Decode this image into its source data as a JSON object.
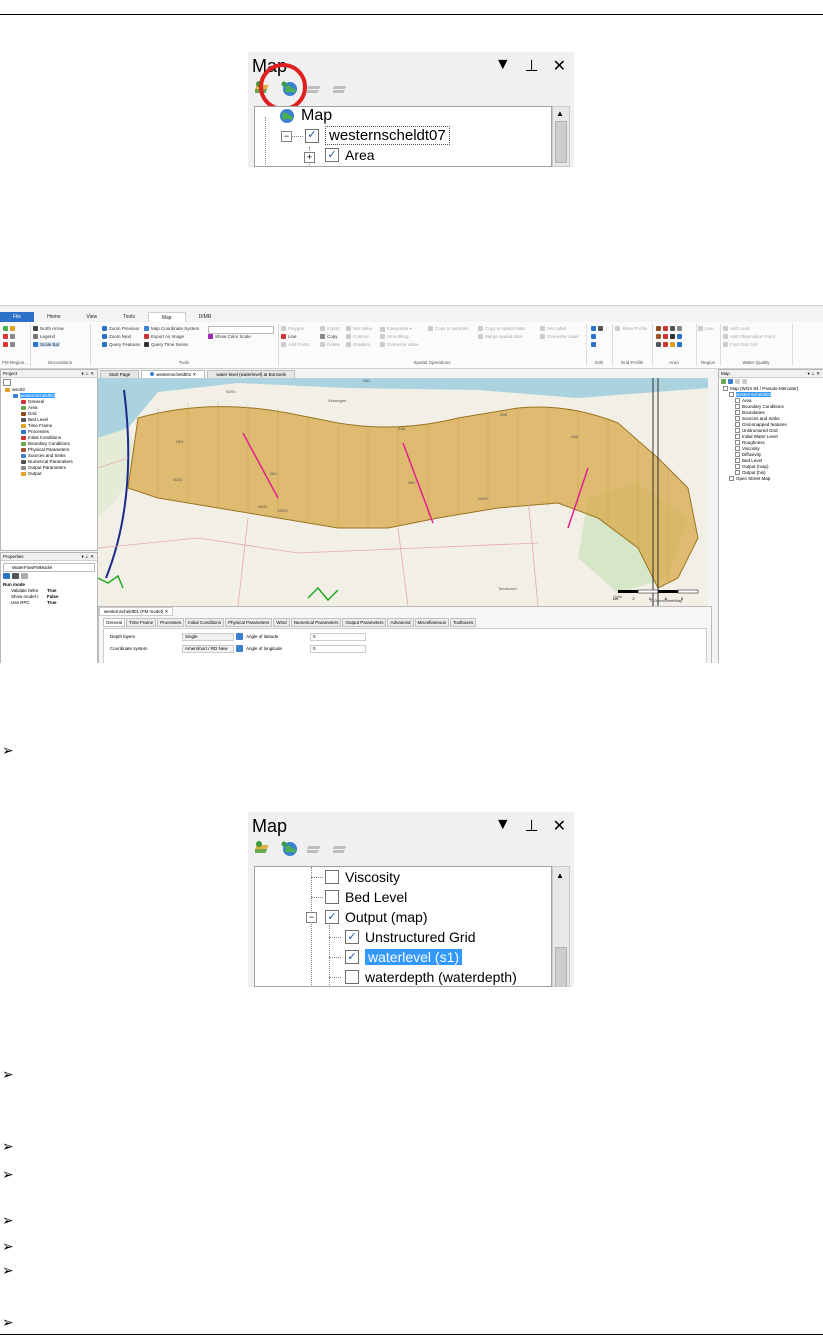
{
  "map_panel_1": {
    "title": "Map",
    "controls": {
      "dropdown": "▼",
      "pin": "⊥",
      "close": "✕"
    },
    "tree": [
      {
        "label": "Map",
        "level": 0,
        "checked": null,
        "expander": "−"
      },
      {
        "label": "westernscheldt07",
        "level": 1,
        "checked": true,
        "expander": "−",
        "focused": true
      },
      {
        "label": "Area",
        "level": 2,
        "checked": true,
        "expander": "+"
      }
    ]
  },
  "app": {
    "menu": [
      "File",
      "Home",
      "View",
      "Tools",
      "Map",
      "DIMR"
    ],
    "ribbon": {
      "fm_region": "FM Region...",
      "decorations": {
        "north_arrow": "North Arrow",
        "legend": "Legend",
        "scale_bar": "Scale Bar",
        "group_label": "Decorations"
      },
      "tools": {
        "zoom_previous": "Zoom Previous",
        "zoom_next": "Zoom Next",
        "query_features": "Query Features",
        "map_coordinate_system": "Map Coordinate System",
        "export_as_image": "Export As Image",
        "query_time_series": "Query Time Series",
        "show_color_scale": "Show Color Scale",
        "group_label": "Tools"
      },
      "spatial": {
        "polygon": "Polygon",
        "line": "Line",
        "add_points": "Add Points",
        "import": "Import",
        "copy": "Copy",
        "delete": "Delete",
        "set_value": "Set Value",
        "contour": "Contour",
        "gradient": "Gradient",
        "interpolate": "Interpolate ▾",
        "smoothing": "Smoothing",
        "overwrite_value": "Overwrite Value",
        "copy_to_samples": "Copy to samples",
        "copy_to_spatial": "Copy to spatial data",
        "merge_spatial": "Merge spatial data",
        "set_label": "Set Label",
        "overwrite_label": "Overwrite Label",
        "group_label": "Spatial Operations"
      },
      "edit": {
        "group_label": "Edit"
      },
      "grid_profile": {
        "show_profile": "Show Profile",
        "group_label": "Grid Profile"
      },
      "area": {
        "group_label": "Area"
      },
      "region": {
        "line": "Line",
        "group_label": "Region"
      },
      "water_quality": {
        "add_load": "Add Load",
        "add_observation_point": "Add Observation Point",
        "find_grid_cell": "Find Grid Cell",
        "group_label": "Water Quality"
      }
    },
    "project_pane": {
      "title": "Project",
      "items": [
        {
          "label": "wsc03",
          "level": 0
        },
        {
          "label": "westernscheldt03",
          "level": 1,
          "selected": true
        },
        {
          "label": "General",
          "level": 2
        },
        {
          "label": "Area",
          "level": 2
        },
        {
          "label": "Grid",
          "level": 2
        },
        {
          "label": "Bed Level",
          "level": 2
        },
        {
          "label": "Time Frame",
          "level": 2
        },
        {
          "label": "Processes",
          "level": 2
        },
        {
          "label": "Initial Conditions",
          "level": 2
        },
        {
          "label": "Boundary Conditions",
          "level": 2
        },
        {
          "label": "Physical Parameters",
          "level": 2
        },
        {
          "label": "Sources and Sinks",
          "level": 2
        },
        {
          "label": "Numerical Parameters",
          "level": 2
        },
        {
          "label": "Output Parameters",
          "level": 2
        },
        {
          "label": "Output",
          "level": 2
        }
      ]
    },
    "properties_pane": {
      "title": "Properties",
      "object": "WaterFlowFMModel",
      "section": "Run mode",
      "rows": [
        {
          "name": "Validate befor",
          "value": "True"
        },
        {
          "name": "Show model r",
          "value": "False"
        },
        {
          "name": "Use RPC",
          "value": "True"
        }
      ]
    },
    "doc_tabs": [
      "Start Page",
      "westernscheldt01",
      "water level (waterlevel) at Borssele"
    ],
    "map_labels": [
      "N294",
      "N62",
      "A58",
      "A58",
      "A58",
      "N61",
      "N61",
      "N252",
      "N62",
      "N289",
      "N253",
      "N291",
      "Hulst",
      "Terneuzen",
      "Vlissingen"
    ],
    "attribution": "© OpenStreetMap",
    "scale_bar": {
      "ticks": [
        "km",
        "2",
        "4",
        "6",
        "8"
      ]
    },
    "map_pane": {
      "title": "Map",
      "items": [
        {
          "label": "Map (WGS 84 / Pseudo-Mercator)",
          "level": 0
        },
        {
          "label": "westernscheldt03",
          "level": 1,
          "selected": true
        },
        {
          "label": "Area",
          "level": 2
        },
        {
          "label": "Boundary Conditions",
          "level": 2
        },
        {
          "label": "Boundaries",
          "level": 2
        },
        {
          "label": "Sources and Sinks",
          "level": 2
        },
        {
          "label": "Grid-snapped features",
          "level": 2
        },
        {
          "label": "Unstructured Grid",
          "level": 2
        },
        {
          "label": "Initial Water Level",
          "level": 2
        },
        {
          "label": "Roughness",
          "level": 2
        },
        {
          "label": "Viscosity",
          "level": 2
        },
        {
          "label": "Diffusivity",
          "level": 2
        },
        {
          "label": "Bed Level",
          "level": 2
        },
        {
          "label": "Output (map)",
          "level": 2
        },
        {
          "label": "Output (his)",
          "level": 2
        },
        {
          "label": "Open Street Map",
          "level": 1
        }
      ]
    },
    "bottom_panel": {
      "tab": "westernscheldt01 (FM model)",
      "subtabs": [
        "General",
        "Time Frame",
        "Processes",
        "Initial Conditions",
        "Physical Parameters",
        "Wind",
        "Numerical Parameters",
        "Output Parameters",
        "Advanced",
        "Miscellaneous",
        "Toolboxes"
      ],
      "fields": [
        {
          "label": "Depth layers",
          "value": "Single",
          "right_label": "Angle of latitude",
          "right_value": "0"
        },
        {
          "label": "Coordinate system",
          "value": "Amersfoort / RD New",
          "right_label": "Angle of longitude",
          "right_value": "0"
        }
      ]
    }
  },
  "map_panel_2": {
    "title": "Map",
    "controls": {
      "dropdown": "▼",
      "pin": "⊥",
      "close": "✕"
    },
    "tree": [
      {
        "label": "Viscosity",
        "level": 2,
        "checked": false
      },
      {
        "label": "Bed Level",
        "level": 2,
        "checked": false
      },
      {
        "label": "Output (map)",
        "level": 2,
        "checked": true,
        "expander": "−"
      },
      {
        "label": "Unstructured Grid",
        "level": 3,
        "checked": true
      },
      {
        "label": "waterlevel (s1)",
        "level": 3,
        "checked": true,
        "selected": true
      },
      {
        "label": "waterdepth (waterdepth)",
        "level": 3,
        "checked": false
      }
    ]
  },
  "bullets": [
    "➢",
    "➢",
    "➢",
    "➢",
    "➢",
    "➢",
    "➢",
    "➢"
  ],
  "colors": {
    "accent": "#2a73c9",
    "highlight": "#e02020",
    "selection": "#3399ff",
    "grid": "#c89320",
    "cross_section": "#e0208c"
  }
}
